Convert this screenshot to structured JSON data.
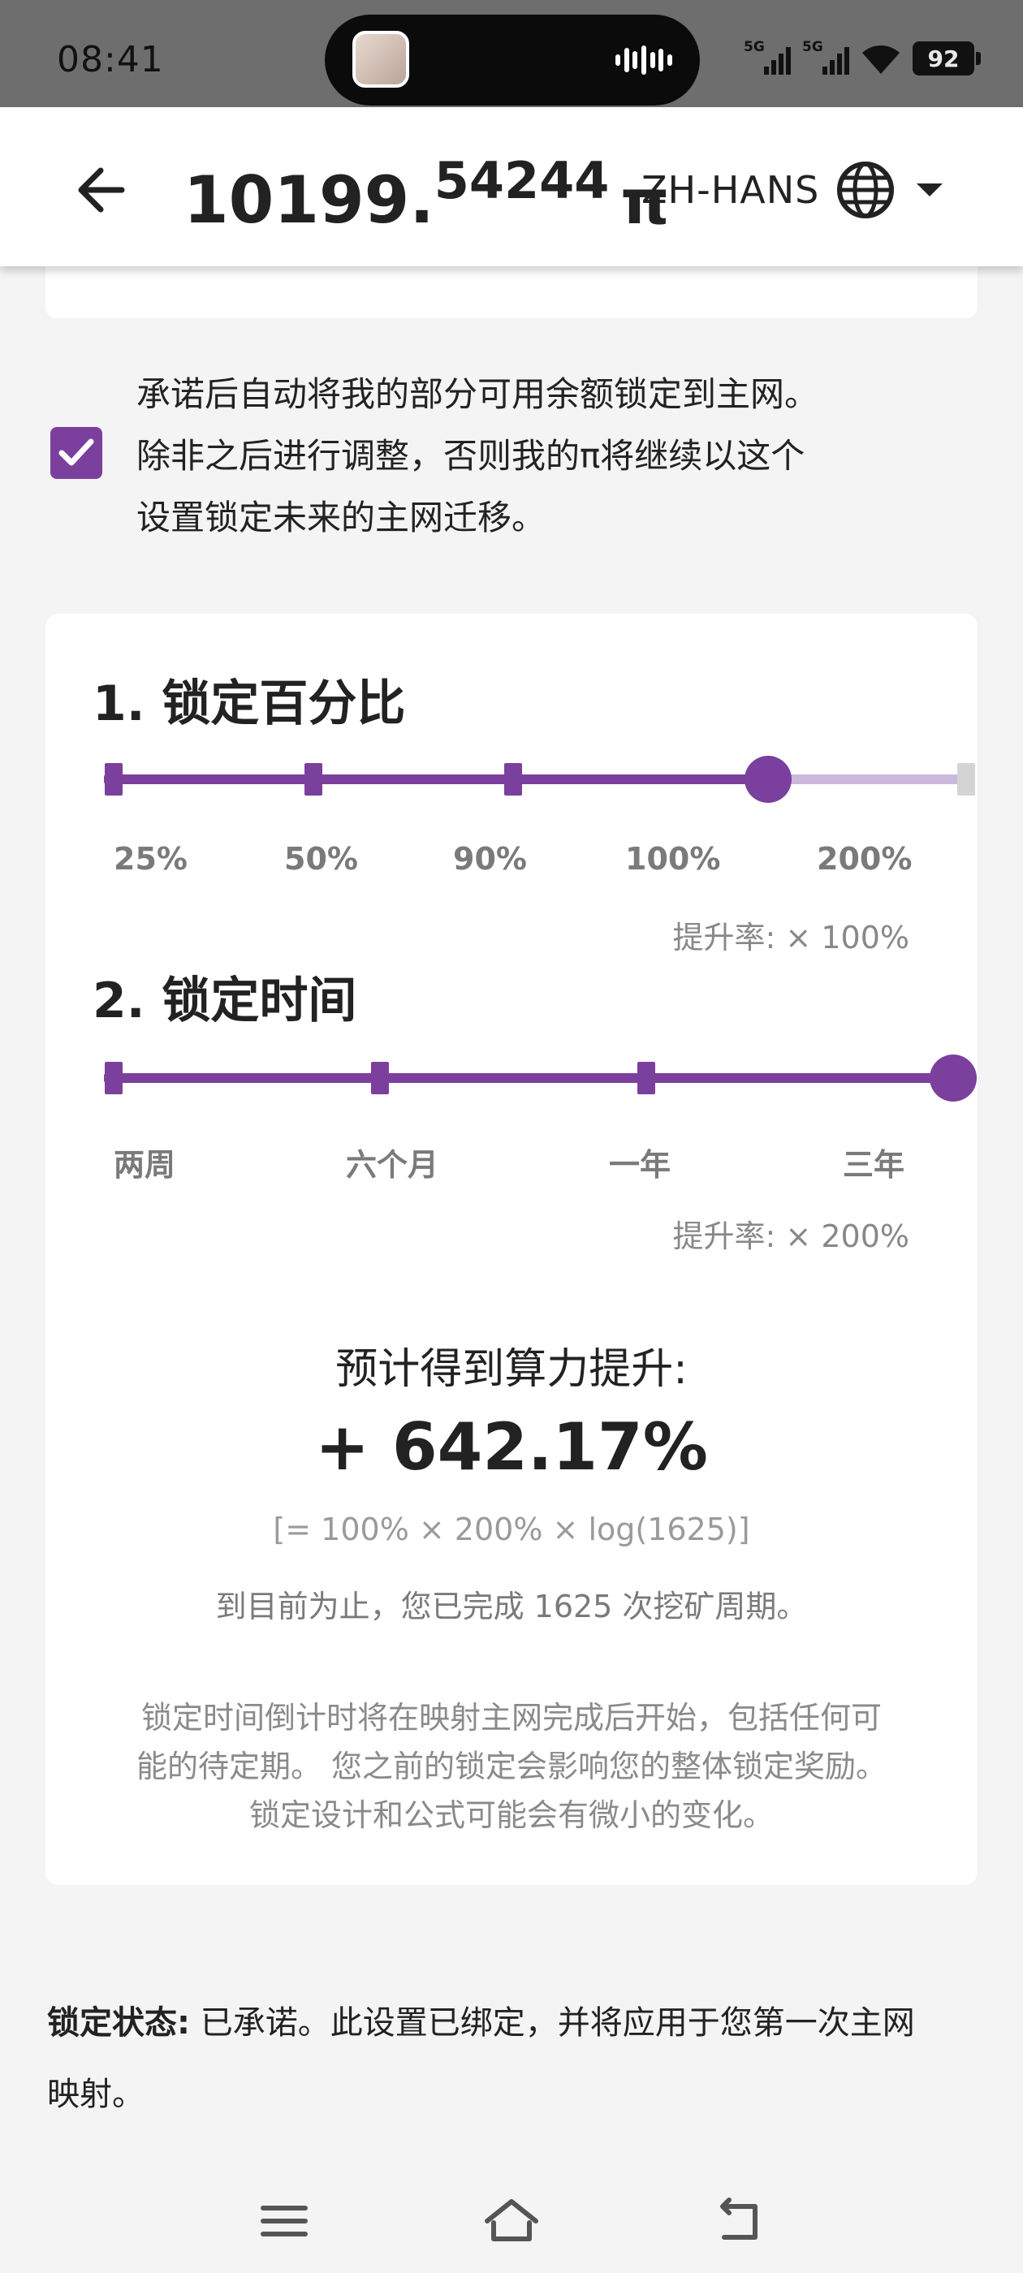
{
  "status_bar": {
    "time": "08:41",
    "signal_1_label": "5G",
    "signal_2_label": "5G",
    "battery": "92"
  },
  "header": {
    "balance_integer": "10199.",
    "balance_decimal": "54244",
    "currency_symbol": "π",
    "language": "ZH-HANS"
  },
  "commitment": {
    "checked": true,
    "text_lines": [
      "承诺后自动将我的部分可用余额锁定到主网。",
      "除非之后进行调整，否则我的π将继续以这个",
      "设置锁定未来的主网迁移。"
    ]
  },
  "lock_percentage": {
    "title": "1. 锁定百分比",
    "options": [
      "25%",
      "50%",
      "90%",
      "100%",
      "200%"
    ],
    "selected_index": 3,
    "rate": "提升率: × 100%"
  },
  "lock_time": {
    "title": "2. 锁定时间",
    "options": [
      "两周",
      "六个月",
      "一年",
      "三年"
    ],
    "selected_index": 3,
    "rate": "提升率: × 200%"
  },
  "estimate": {
    "label": "预计得到算力提升:",
    "value": "+ 642.17%",
    "formula": "[= 100% × 200% × log(1625)]",
    "cycles": "到目前为止，您已完成 1625 次挖矿周期。"
  },
  "note_lines": [
    "锁定时间倒计时将在映射主网完成后开始，包括任何可",
    "能的待定期。 您之前的锁定会影响您的整体锁定奖励。",
    "锁定设计和公式可能会有微小的变化。"
  ],
  "lock_status": {
    "label": "锁定状态:",
    "line1": " 已承诺。此设置已绑定，并将应用于您第一次主网",
    "line2": "映射。"
  },
  "colors": {
    "accent": "#7b3f9d",
    "accent_light": "#ccb8dc",
    "inactive_stop": "#d4d4d4"
  }
}
